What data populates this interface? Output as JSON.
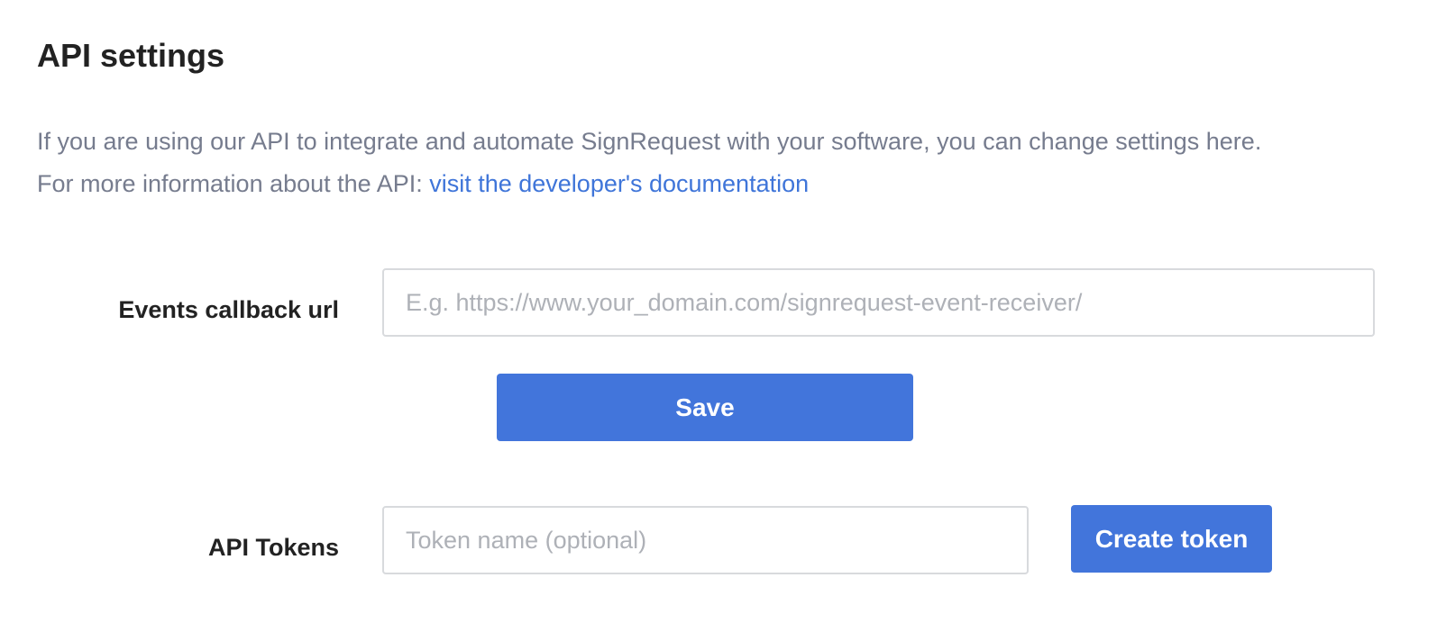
{
  "page": {
    "title": "API settings",
    "description_line1": "If you are using our API to integrate and automate SignRequest with your software, you can change settings here.",
    "description_line2_prefix": "For more information about the API: ",
    "docs_link_text": "visit the developer's documentation"
  },
  "callback": {
    "label": "Events callback url",
    "value": "",
    "placeholder": "E.g. https://www.your_domain.com/signrequest-event-receiver/",
    "save_label": "Save"
  },
  "tokens": {
    "label": "API Tokens",
    "value": "",
    "placeholder": "Token name (optional)",
    "create_label": "Create token"
  },
  "colors": {
    "accent": "#4275db",
    "link": "#3f75d9",
    "muted_text": "#767c8e",
    "heading_text": "#222222"
  }
}
